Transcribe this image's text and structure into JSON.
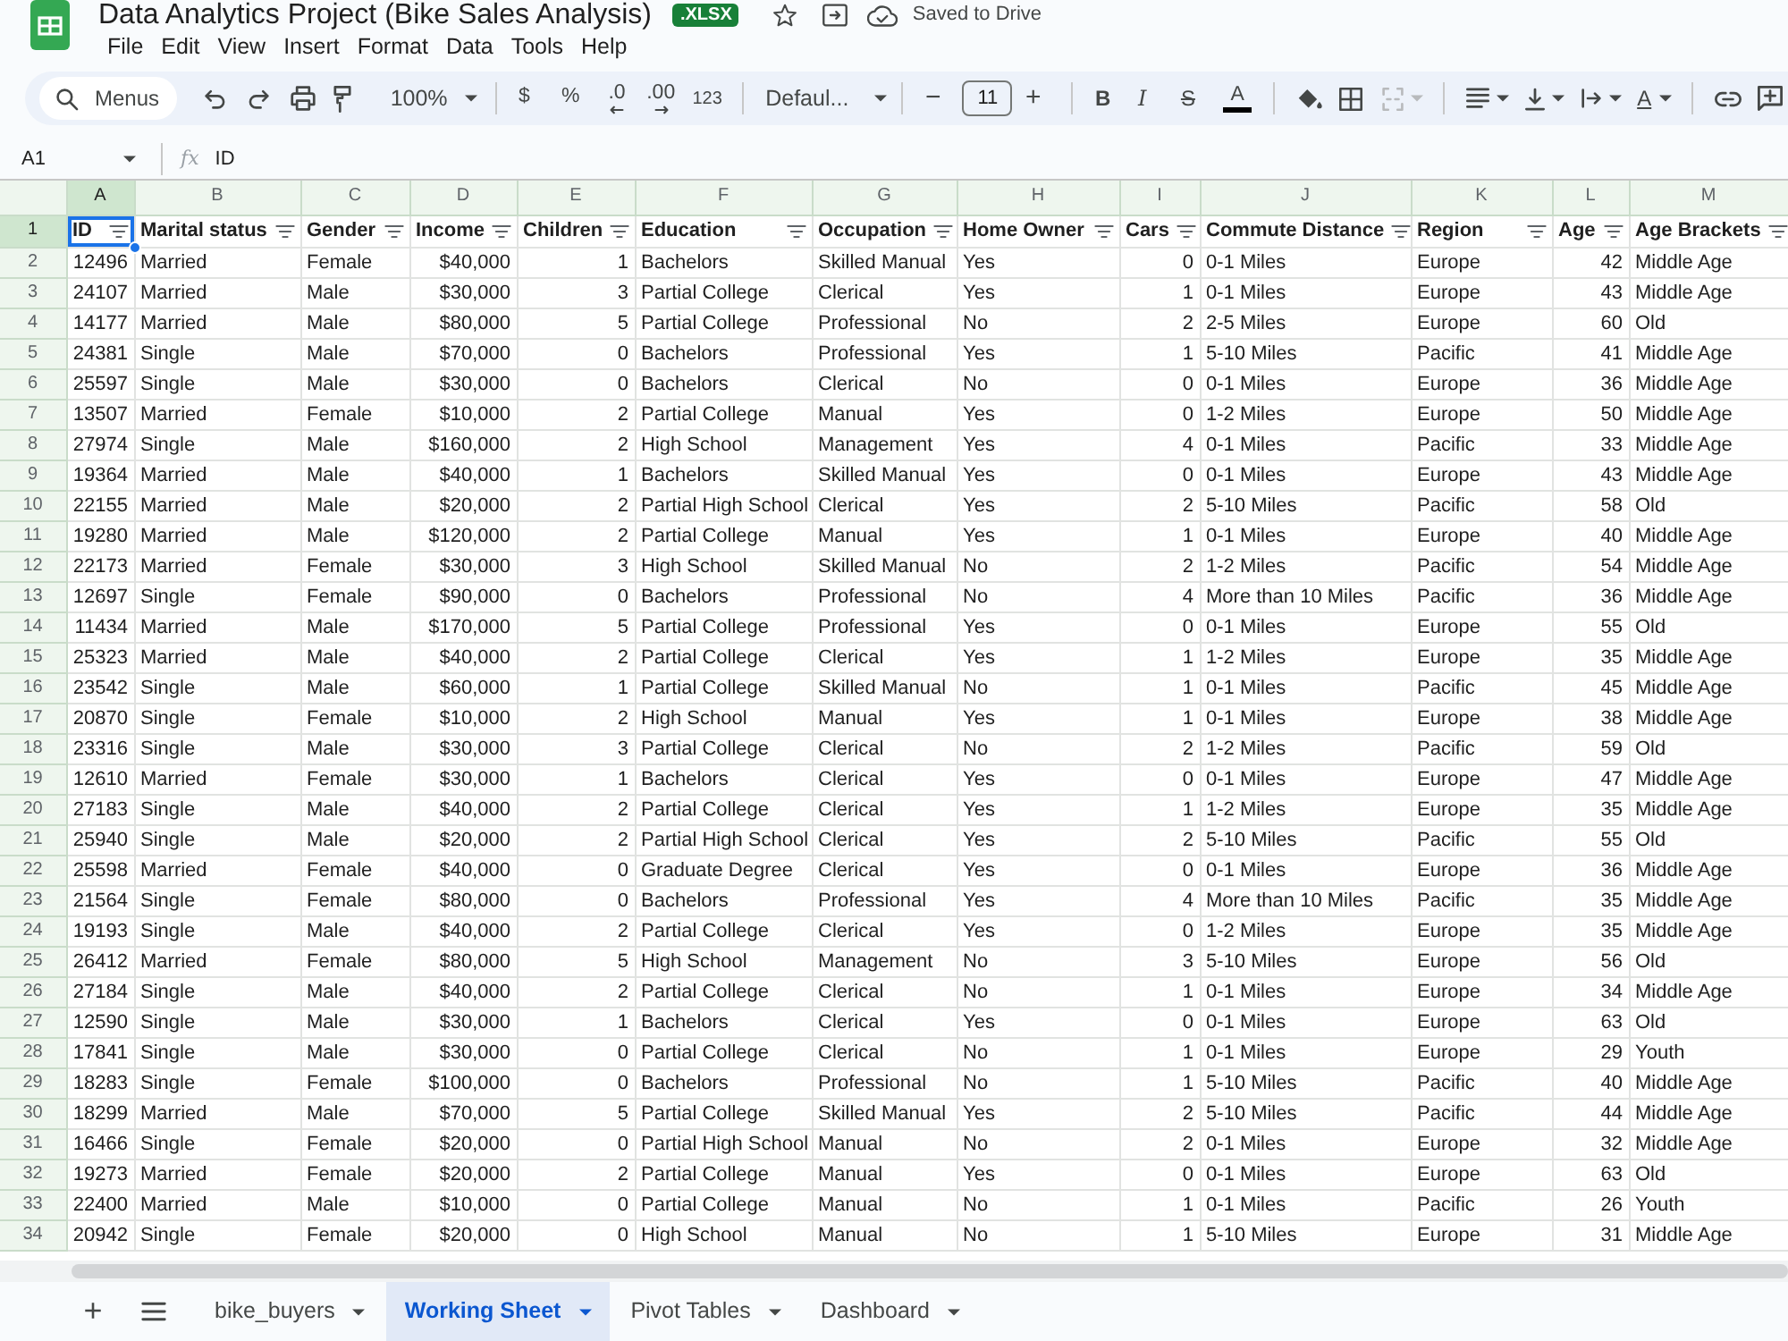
{
  "app": {
    "title": "Data Analytics Project (Bike Sales Analysis)",
    "file_type": ".XLSX",
    "save_status": "Saved to Drive"
  },
  "menu": [
    "File",
    "Edit",
    "View",
    "Insert",
    "Format",
    "Data",
    "Tools",
    "Help"
  ],
  "toolbar": {
    "search": "Menus",
    "zoom": "100%",
    "currency": "$",
    "percent": "%",
    "fewer_decimals": ".0",
    "more_decimals": ".00",
    "number_format": "123",
    "font": "Defaul...",
    "size_minus": "−",
    "font_size": "11",
    "size_plus": "+",
    "bold": "B",
    "italic": "I",
    "strikethrough": "S",
    "text_color": "A",
    "merge": {
      "disabled": true
    },
    "rotate": "A"
  },
  "formula_bar": {
    "cell_ref": "A1",
    "fx": "fx",
    "content": "ID"
  },
  "sheet": {
    "columns": [
      {
        "letter": "A",
        "kind": "number",
        "selected": true
      },
      {
        "letter": "B",
        "kind": "text",
        "selected": false
      },
      {
        "letter": "C",
        "kind": "text",
        "selected": false
      },
      {
        "letter": "D",
        "kind": "number",
        "selected": false
      },
      {
        "letter": "E",
        "kind": "number",
        "selected": false
      },
      {
        "letter": "F",
        "kind": "text",
        "selected": false
      },
      {
        "letter": "G",
        "kind": "text",
        "selected": false
      },
      {
        "letter": "H",
        "kind": "text",
        "selected": false
      },
      {
        "letter": "I",
        "kind": "number",
        "selected": false
      },
      {
        "letter": "J",
        "kind": "text",
        "selected": false
      },
      {
        "letter": "K",
        "kind": "text",
        "selected": false
      },
      {
        "letter": "L",
        "kind": "number",
        "selected": false
      },
      {
        "letter": "M",
        "kind": "text",
        "selected": false
      }
    ],
    "header_row": {
      "number": "1",
      "selected": true,
      "cells": [
        "ID",
        "Marital status",
        "Gender",
        "Income",
        "Children",
        "Education",
        "Occupation",
        "Home Owner",
        "Cars",
        "Commute Distance",
        "Region",
        "Age",
        "Age Brackets"
      ]
    },
    "rows": [
      {
        "number": "2",
        "selected": false,
        "cells": [
          "12496",
          "Married",
          "Female",
          "$40,000",
          "1",
          "Bachelors",
          "Skilled Manual",
          "Yes",
          "0",
          "0-1 Miles",
          "Europe",
          "42",
          "Middle Age"
        ]
      },
      {
        "number": "3",
        "selected": false,
        "cells": [
          "24107",
          "Married",
          "Male",
          "$30,000",
          "3",
          "Partial College",
          "Clerical",
          "Yes",
          "1",
          "0-1 Miles",
          "Europe",
          "43",
          "Middle Age"
        ]
      },
      {
        "number": "4",
        "selected": false,
        "cells": [
          "14177",
          "Married",
          "Male",
          "$80,000",
          "5",
          "Partial College",
          "Professional",
          "No",
          "2",
          "2-5 Miles",
          "Europe",
          "60",
          "Old"
        ]
      },
      {
        "number": "5",
        "selected": false,
        "cells": [
          "24381",
          "Single",
          "Male",
          "$70,000",
          "0",
          "Bachelors",
          "Professional",
          "Yes",
          "1",
          "5-10 Miles",
          "Pacific",
          "41",
          "Middle Age"
        ]
      },
      {
        "number": "6",
        "selected": false,
        "cells": [
          "25597",
          "Single",
          "Male",
          "$30,000",
          "0",
          "Bachelors",
          "Clerical",
          "No",
          "0",
          "0-1 Miles",
          "Europe",
          "36",
          "Middle Age"
        ]
      },
      {
        "number": "7",
        "selected": false,
        "cells": [
          "13507",
          "Married",
          "Female",
          "$10,000",
          "2",
          "Partial College",
          "Manual",
          "Yes",
          "0",
          "1-2 Miles",
          "Europe",
          "50",
          "Middle Age"
        ]
      },
      {
        "number": "8",
        "selected": false,
        "cells": [
          "27974",
          "Single",
          "Male",
          "$160,000",
          "2",
          "High School",
          "Management",
          "Yes",
          "4",
          "0-1 Miles",
          "Pacific",
          "33",
          "Middle Age"
        ]
      },
      {
        "number": "9",
        "selected": false,
        "cells": [
          "19364",
          "Married",
          "Male",
          "$40,000",
          "1",
          "Bachelors",
          "Skilled Manual",
          "Yes",
          "0",
          "0-1 Miles",
          "Europe",
          "43",
          "Middle Age"
        ]
      },
      {
        "number": "10",
        "selected": false,
        "cells": [
          "22155",
          "Married",
          "Male",
          "$20,000",
          "2",
          "Partial High School",
          "Clerical",
          "Yes",
          "2",
          "5-10 Miles",
          "Pacific",
          "58",
          "Old"
        ]
      },
      {
        "number": "11",
        "selected": false,
        "cells": [
          "19280",
          "Married",
          "Male",
          "$120,000",
          "2",
          "Partial College",
          "Manual",
          "Yes",
          "1",
          "0-1 Miles",
          "Europe",
          "40",
          "Middle Age"
        ]
      },
      {
        "number": "12",
        "selected": false,
        "cells": [
          "22173",
          "Married",
          "Female",
          "$30,000",
          "3",
          "High School",
          "Skilled Manual",
          "No",
          "2",
          "1-2 Miles",
          "Pacific",
          "54",
          "Middle Age"
        ]
      },
      {
        "number": "13",
        "selected": false,
        "cells": [
          "12697",
          "Single",
          "Female",
          "$90,000",
          "0",
          "Bachelors",
          "Professional",
          "No",
          "4",
          "More than 10 Miles",
          "Pacific",
          "36",
          "Middle Age"
        ]
      },
      {
        "number": "14",
        "selected": false,
        "cells": [
          "11434",
          "Married",
          "Male",
          "$170,000",
          "5",
          "Partial College",
          "Professional",
          "Yes",
          "0",
          "0-1 Miles",
          "Europe",
          "55",
          "Old"
        ]
      },
      {
        "number": "15",
        "selected": false,
        "cells": [
          "25323",
          "Married",
          "Male",
          "$40,000",
          "2",
          "Partial College",
          "Clerical",
          "Yes",
          "1",
          "1-2 Miles",
          "Europe",
          "35",
          "Middle Age"
        ]
      },
      {
        "number": "16",
        "selected": false,
        "cells": [
          "23542",
          "Single",
          "Male",
          "$60,000",
          "1",
          "Partial College",
          "Skilled Manual",
          "No",
          "1",
          "0-1 Miles",
          "Pacific",
          "45",
          "Middle Age"
        ]
      },
      {
        "number": "17",
        "selected": false,
        "cells": [
          "20870",
          "Single",
          "Female",
          "$10,000",
          "2",
          "High School",
          "Manual",
          "Yes",
          "1",
          "0-1 Miles",
          "Europe",
          "38",
          "Middle Age"
        ]
      },
      {
        "number": "18",
        "selected": false,
        "cells": [
          "23316",
          "Single",
          "Male",
          "$30,000",
          "3",
          "Partial College",
          "Clerical",
          "No",
          "2",
          "1-2 Miles",
          "Pacific",
          "59",
          "Old"
        ]
      },
      {
        "number": "19",
        "selected": false,
        "cells": [
          "12610",
          "Married",
          "Female",
          "$30,000",
          "1",
          "Bachelors",
          "Clerical",
          "Yes",
          "0",
          "0-1 Miles",
          "Europe",
          "47",
          "Middle Age"
        ]
      },
      {
        "number": "20",
        "selected": false,
        "cells": [
          "27183",
          "Single",
          "Male",
          "$40,000",
          "2",
          "Partial College",
          "Clerical",
          "Yes",
          "1",
          "1-2 Miles",
          "Europe",
          "35",
          "Middle Age"
        ]
      },
      {
        "number": "21",
        "selected": false,
        "cells": [
          "25940",
          "Single",
          "Male",
          "$20,000",
          "2",
          "Partial High School",
          "Clerical",
          "Yes",
          "2",
          "5-10 Miles",
          "Pacific",
          "55",
          "Old"
        ]
      },
      {
        "number": "22",
        "selected": false,
        "cells": [
          "25598",
          "Married",
          "Female",
          "$40,000",
          "0",
          "Graduate Degree",
          "Clerical",
          "Yes",
          "0",
          "0-1 Miles",
          "Europe",
          "36",
          "Middle Age"
        ]
      },
      {
        "number": "23",
        "selected": false,
        "cells": [
          "21564",
          "Single",
          "Female",
          "$80,000",
          "0",
          "Bachelors",
          "Professional",
          "Yes",
          "4",
          "More than 10 Miles",
          "Pacific",
          "35",
          "Middle Age"
        ]
      },
      {
        "number": "24",
        "selected": false,
        "cells": [
          "19193",
          "Single",
          "Male",
          "$40,000",
          "2",
          "Partial College",
          "Clerical",
          "Yes",
          "0",
          "1-2 Miles",
          "Europe",
          "35",
          "Middle Age"
        ]
      },
      {
        "number": "25",
        "selected": false,
        "cells": [
          "26412",
          "Married",
          "Female",
          "$80,000",
          "5",
          "High School",
          "Management",
          "No",
          "3",
          "5-10 Miles",
          "Europe",
          "56",
          "Old"
        ]
      },
      {
        "number": "26",
        "selected": false,
        "cells": [
          "27184",
          "Single",
          "Male",
          "$40,000",
          "2",
          "Partial College",
          "Clerical",
          "No",
          "1",
          "0-1 Miles",
          "Europe",
          "34",
          "Middle Age"
        ]
      },
      {
        "number": "27",
        "selected": false,
        "cells": [
          "12590",
          "Single",
          "Male",
          "$30,000",
          "1",
          "Bachelors",
          "Clerical",
          "Yes",
          "0",
          "0-1 Miles",
          "Europe",
          "63",
          "Old"
        ]
      },
      {
        "number": "28",
        "selected": false,
        "cells": [
          "17841",
          "Single",
          "Male",
          "$30,000",
          "0",
          "Partial College",
          "Clerical",
          "No",
          "1",
          "0-1 Miles",
          "Europe",
          "29",
          "Youth"
        ]
      },
      {
        "number": "29",
        "selected": false,
        "cells": [
          "18283",
          "Single",
          "Female",
          "$100,000",
          "0",
          "Bachelors",
          "Professional",
          "No",
          "1",
          "5-10 Miles",
          "Pacific",
          "40",
          "Middle Age"
        ]
      },
      {
        "number": "30",
        "selected": false,
        "cells": [
          "18299",
          "Married",
          "Male",
          "$70,000",
          "5",
          "Partial College",
          "Skilled Manual",
          "Yes",
          "2",
          "5-10 Miles",
          "Pacific",
          "44",
          "Middle Age"
        ]
      },
      {
        "number": "31",
        "selected": false,
        "cells": [
          "16466",
          "Single",
          "Female",
          "$20,000",
          "0",
          "Partial High School",
          "Manual",
          "No",
          "2",
          "0-1 Miles",
          "Europe",
          "32",
          "Middle Age"
        ]
      },
      {
        "number": "32",
        "selected": false,
        "cells": [
          "19273",
          "Married",
          "Female",
          "$20,000",
          "2",
          "Partial College",
          "Manual",
          "Yes",
          "0",
          "0-1 Miles",
          "Europe",
          "63",
          "Old"
        ]
      },
      {
        "number": "33",
        "selected": false,
        "cells": [
          "22400",
          "Married",
          "Male",
          "$10,000",
          "0",
          "Partial College",
          "Manual",
          "No",
          "1",
          "0-1 Miles",
          "Pacific",
          "26",
          "Youth"
        ]
      },
      {
        "number": "34",
        "selected": false,
        "cells": [
          "20942",
          "Single",
          "Female",
          "$20,000",
          "0",
          "High School",
          "Manual",
          "No",
          "1",
          "5-10 Miles",
          "Europe",
          "31",
          "Middle Age"
        ]
      }
    ]
  },
  "sheet_tabs": {
    "add": "+",
    "tabs": [
      {
        "label": "bike_buyers",
        "selected": false
      },
      {
        "label": "Working Sheet",
        "selected": true
      },
      {
        "label": "Pivot Tables",
        "selected": false
      },
      {
        "label": "Dashboard",
        "selected": false
      }
    ]
  }
}
